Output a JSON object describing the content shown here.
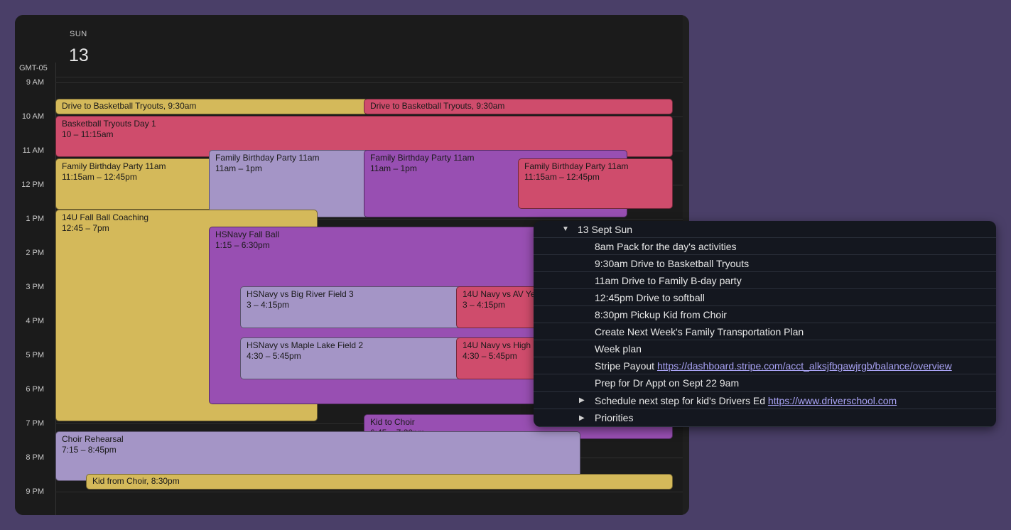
{
  "calendar": {
    "day_name": "SUN",
    "day_number": "13",
    "timezone": "GMT-05",
    "hours": [
      "9 AM",
      "10 AM",
      "11 AM",
      "12 PM",
      "1 PM",
      "2 PM",
      "3 PM",
      "4 PM",
      "5 PM",
      "6 PM",
      "7 PM",
      "8 PM",
      "9 PM"
    ],
    "events": [
      {
        "title": "Drive to Basketball Tryouts",
        "time": ", 9:30am"
      },
      {
        "title": "Drive to Basketball Tryouts",
        "time": ", 9:30am"
      },
      {
        "title": "Basketball Tryouts Day 1",
        "time": "10 – 11:15am"
      },
      {
        "title": "Family Birthday Party 11am",
        "time": "11:15am – 12:45pm"
      },
      {
        "title": "Family Birthday Party 11am",
        "time": "11am – 1pm"
      },
      {
        "title": "Family Birthday Party 11am",
        "time": "11am – 1pm"
      },
      {
        "title": "Family Birthday Party 11am",
        "time": "11:15am – 12:45pm"
      },
      {
        "title": "14U Fall Ball Coaching",
        "time": "12:45 – 7pm"
      },
      {
        "title": "HSNavy Fall Ball",
        "time": "1:15 – 6:30pm"
      },
      {
        "title": "HSNavy vs Big River Field 3",
        "time": "3 – 4:15pm"
      },
      {
        "title": "14U Navy vs AV Ye",
        "time": "3 – 4:15pm"
      },
      {
        "title": "HSNavy vs Maple Lake Field 2",
        "time": "4:30 – 5:45pm"
      },
      {
        "title": "14U Navy vs High",
        "time": "4:30 – 5:45pm"
      },
      {
        "title": "Kid to Choir",
        "time": "6:45 – 7:30pm"
      },
      {
        "title": "Choir Rehearsal",
        "time": "7:15 – 8:45pm"
      },
      {
        "title": "Kid from Choir",
        "time": ", 8:30pm"
      }
    ],
    "colors": {
      "yellow": "#d4b95a",
      "red": "#cf4c6c",
      "lavender": "#a495c6",
      "purple": "#984fb2"
    }
  },
  "outline": {
    "header": {
      "icon": "triangle-down-icon",
      "label": "13 Sept Sun"
    },
    "items": [
      {
        "text": "8am Pack for the day's activities"
      },
      {
        "text": "9:30am Drive to Basketball Tryouts"
      },
      {
        "text": "11am Drive to Family B-day party"
      },
      {
        "text": "12:45pm Drive to softball"
      },
      {
        "text": "8:30pm Pickup Kid from Choir"
      },
      {
        "text": "Create Next Week's Family Transportation Plan"
      },
      {
        "text": "Week plan"
      },
      {
        "text": "Stripe Payout ",
        "link": "https://dashboard.stripe.com/acct_alksjfbgawjrgb/balance/overview"
      },
      {
        "text": "Prep for Dr Appt on Sept 22 9am"
      },
      {
        "text": "Schedule next step for kid's Drivers Ed ",
        "link": "https://www.driverschool.com",
        "collapsed": true
      },
      {
        "text": "Priorities",
        "collapsed": true
      }
    ]
  }
}
